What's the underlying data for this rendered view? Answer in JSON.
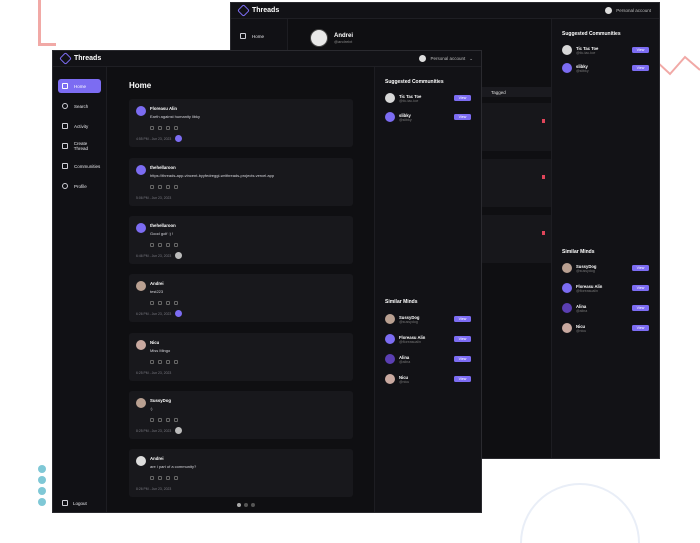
{
  "back": {
    "brand": "Threads",
    "account": "Personal account",
    "nav": [
      {
        "label": "Home"
      }
    ],
    "profile": {
      "name": "Andrei",
      "handle": "@andreixt"
    },
    "tab_label": "Tagged",
    "suggested_title": "Suggested Communities",
    "communities": [
      {
        "name": "Tic Tac Toe",
        "handle": "@tic-tac-toe"
      },
      {
        "name": "slibky",
        "handle": "@slibky"
      }
    ],
    "minds_title": "Similar Minds",
    "minds": [
      {
        "name": "SussyDog",
        "handle": "@sussydog"
      },
      {
        "name": "Floreasu Alin",
        "handle": "@floreasualin"
      },
      {
        "name": "Alina",
        "handle": "@alina"
      },
      {
        "name": "Nicu",
        "handle": "@nicu"
      }
    ],
    "view_label": "View"
  },
  "front": {
    "brand": "Threads",
    "account": "Personal account",
    "nav": [
      {
        "label": "Home"
      },
      {
        "label": "Search"
      },
      {
        "label": "Activity"
      },
      {
        "label": "Create Thread"
      },
      {
        "label": "Communities"
      },
      {
        "label": "Profile"
      }
    ],
    "logout": "Logout",
    "page_title": "Home",
    "threads": [
      {
        "author": "Floreasu Alin",
        "text": "Earth against humanity libky",
        "date": "4:55 PM - Jun 23, 2023"
      },
      {
        "author": "thehellaroon",
        "text": "https://threads-app-vincent-byyfedreggi-writhreads-projects.vercel.app",
        "date": "5:06 PM - Jun 23, 2023"
      },
      {
        "author": "thehellaroon",
        "text": "Good golf :) !",
        "date": "6:46 PM - Jun 23, 2023"
      },
      {
        "author": "Andrei",
        "text": "test223",
        "date": "6:26 PM - Jun 23, 2023"
      },
      {
        "author": "Nicu",
        "text": "Miss Mingo",
        "date": "6:25 PM - Jun 23, 2023"
      },
      {
        "author": "SussyDog",
        "text": ":)",
        "date": "8:25 PM - Jun 23, 2023"
      },
      {
        "author": "Andrei",
        "text": "are i part of a community?",
        "date": "8:26 PM - Jun 23, 2023"
      }
    ],
    "suggested_title": "Suggested Communities",
    "communities": [
      {
        "name": "Tic Tac Toe",
        "handle": "@tic-tac-toe"
      },
      {
        "name": "slibky",
        "handle": "@slibky"
      }
    ],
    "minds_title": "Similar Minds",
    "minds": [
      {
        "name": "SussyDog",
        "handle": "@sussydog"
      },
      {
        "name": "Floreasu Alin",
        "handle": "@floreasualin"
      },
      {
        "name": "Alina",
        "handle": "@alina"
      },
      {
        "name": "Nicu",
        "handle": "@nicu"
      }
    ],
    "view_label": "View"
  }
}
